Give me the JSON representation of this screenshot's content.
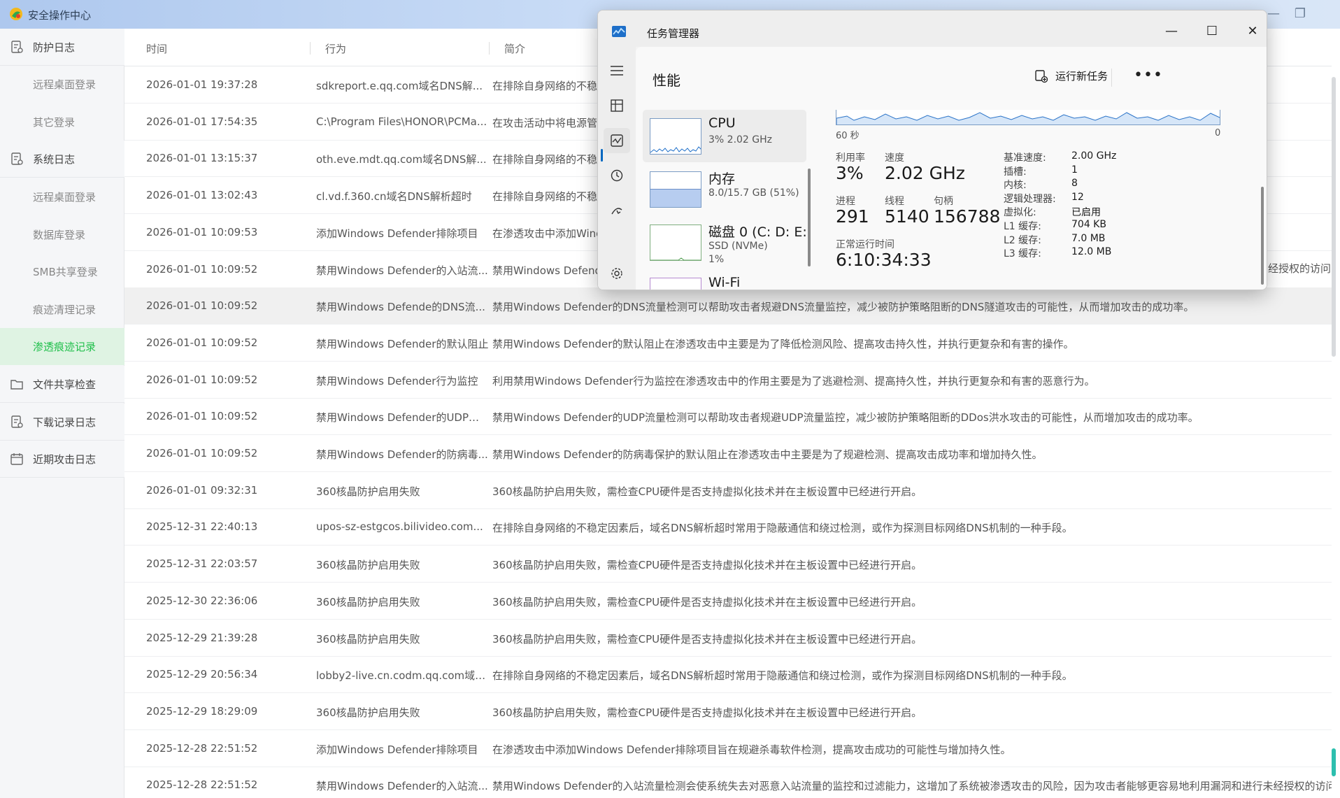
{
  "app": {
    "title": "安全操作中心",
    "sidebar": [
      {
        "label": "防护日志",
        "type": "group",
        "icon": "log-icon"
      },
      {
        "label": "远程桌面登录",
        "type": "sub"
      },
      {
        "label": "其它登录",
        "type": "sub"
      },
      {
        "label": "系统日志",
        "type": "group",
        "icon": "log-icon"
      },
      {
        "label": "远程桌面登录",
        "type": "sub"
      },
      {
        "label": "数据库登录",
        "type": "sub"
      },
      {
        "label": "SMB共享登录",
        "type": "sub"
      },
      {
        "label": "痕迹清理记录",
        "type": "sub"
      },
      {
        "label": "渗透痕迹记录",
        "type": "sub",
        "active": true
      },
      {
        "label": "文件共享检查",
        "type": "group",
        "icon": "folder-icon"
      },
      {
        "label": "下载记录日志",
        "type": "group",
        "icon": "log-icon"
      },
      {
        "label": "近期攻击日志",
        "type": "group",
        "icon": "calendar-icon"
      }
    ],
    "table": {
      "headers": {
        "time": "时间",
        "action": "行为",
        "desc": "简介"
      },
      "rows": [
        {
          "time": "2026-01-01 19:37:28",
          "action": "sdkreport.e.qq.com域名DNS解...",
          "desc": "在排除自身网络的不稳"
        },
        {
          "time": "2026-01-01 17:54:35",
          "action": "C:\\Program Files\\HONOR\\PCMa...",
          "desc": "在攻击活动中将电源管"
        },
        {
          "time": "2026-01-01 13:15:37",
          "action": "oth.eve.mdt.qq.com域名DNS解...",
          "desc": "在排除自身网络的不稳"
        },
        {
          "time": "2026-01-01 13:02:43",
          "action": "cl.vd.f.360.cn域名DNS解析超时",
          "desc": "在排除自身网络的不稳"
        },
        {
          "time": "2026-01-01 10:09:53",
          "action": "添加Windows Defender排除项目",
          "desc": "在渗透攻击中添加Wind"
        },
        {
          "time": "2026-01-01 10:09:52",
          "action": "禁用Windows Defender的入站流...",
          "desc": "禁用Windows Defend"
        },
        {
          "time": "2026-01-01 10:09:52",
          "action": "禁用Windows Defende的DNS流...",
          "desc": "禁用Windows Defender的DNS流量检测可以帮助攻击者规避DNS流量监控，减少被防护策略阻断的DNS隧道攻击的可能性，从而增加攻击的成功率。",
          "highlight": true
        },
        {
          "time": "2026-01-01 10:09:52",
          "action": "禁用Windows Defender的默认阻止",
          "desc": "禁用Windows Defender的默认阻止在渗透攻击中主要是为了降低检测风险、提高攻击持久性，并执行更复杂和有害的操作。"
        },
        {
          "time": "2026-01-01 10:09:52",
          "action": "禁用Windows Defender行为监控",
          "desc": "利用禁用Windows Defender行为监控在渗透攻击中的作用主要是为了逃避检测、提高持久性，并执行更复杂和有害的恶意行为。"
        },
        {
          "time": "2026-01-01 10:09:52",
          "action": "禁用Windows Defender的UDP流...",
          "desc": "禁用Windows Defender的UDP流量检测可以帮助攻击者规避UDP流量监控，减少被防护策略阻断的DDos洪水攻击的可能性，从而增加攻击的成功率。"
        },
        {
          "time": "2026-01-01 10:09:52",
          "action": "禁用Windows Defender的防病毒...",
          "desc": "禁用Windows Defender的防病毒保护的默认阻止在渗透攻击中主要是为了规避检测、提高攻击成功率和增加持久性。"
        },
        {
          "time": "2026-01-01 09:32:31",
          "action": "360核晶防护启用失败",
          "desc": "360核晶防护启用失败，需检查CPU硬件是否支持虚拟化技术并在主板设置中已经进行开启。"
        },
        {
          "time": "2025-12-31 22:40:13",
          "action": "upos-sz-estgcos.bilivideo.com...",
          "desc": "在排除自身网络的不稳定因素后，域名DNS解析超时常用于隐蔽通信和绕过检测，或作为探测目标网络DNS机制的一种手段。"
        },
        {
          "time": "2025-12-31 22:03:57",
          "action": "360核晶防护启用失败",
          "desc": "360核晶防护启用失败，需检查CPU硬件是否支持虚拟化技术并在主板设置中已经进行开启。"
        },
        {
          "time": "2025-12-30 22:36:06",
          "action": "360核晶防护启用失败",
          "desc": "360核晶防护启用失败，需检查CPU硬件是否支持虚拟化技术并在主板设置中已经进行开启。"
        },
        {
          "time": "2025-12-29 21:39:28",
          "action": "360核晶防护启用失败",
          "desc": "360核晶防护启用失败，需检查CPU硬件是否支持虚拟化技术并在主板设置中已经进行开启。"
        },
        {
          "time": "2025-12-29 20:56:34",
          "action": "lobby2-live.cn.codm.qq.com域名...",
          "desc": "在排除自身网络的不稳定因素后，域名DNS解析超时常用于隐蔽通信和绕过检测，或作为探测目标网络DNS机制的一种手段。"
        },
        {
          "time": "2025-12-29 18:29:09",
          "action": "360核晶防护启用失败",
          "desc": "360核晶防护启用失败，需检查CPU硬件是否支持虚拟化技术并在主板设置中已经进行开启。"
        },
        {
          "time": "2025-12-28 22:51:52",
          "action": "添加Windows Defender排除项目",
          "desc": "在渗透攻击中添加Windows Defender排除项目旨在规避杀毒软件检测，提高攻击成功的可能性与增加持久性。"
        },
        {
          "time": "2025-12-28 22:51:52",
          "action": "禁用Windows Defender的入站流...",
          "desc": "禁用Windows Defender的入站流量检测会使系统失去对恶意入站流量的监控和过滤能力，这增加了系统被渗透攻击的风险，因为攻击者能够更容易地利用漏洞和进行未经授权的访问"
        }
      ],
      "overflow_text_row6": "经授权的访问"
    }
  },
  "taskmgr": {
    "title": "任务管理器",
    "page_title": "性能",
    "run_task_label": "运行新任务",
    "more_label": "•••",
    "nav_icons": [
      "menu-icon",
      "processes-icon",
      "performance-icon",
      "history-icon",
      "startup-icon",
      "settings-icon"
    ],
    "resources": [
      {
        "name": "CPU",
        "line1": "3% 2.02 GHz",
        "line2": ""
      },
      {
        "name": "内存",
        "line1": "8.0/15.7 GB (51%)",
        "line2": ""
      },
      {
        "name": "磁盘 0 (C: D: E:",
        "line1": "SSD (NVMe)",
        "line2": "1%"
      },
      {
        "name": "Wi-Fi",
        "line1": "",
        "line2": ""
      }
    ],
    "graph": {
      "left_label": "60 秒",
      "right_label": "0"
    },
    "stats": {
      "util_label": "利用率",
      "util_value": "3%",
      "speed_label": "速度",
      "speed_value": "2.02 GHz",
      "proc_label": "进程",
      "proc_value": "291",
      "thread_label": "线程",
      "thread_value": "5140",
      "handle_label": "句柄",
      "handle_value": "156788",
      "uptime_label": "正常运行时间",
      "uptime_value": "6:10:34:33"
    },
    "details": [
      {
        "k": "基准速度:",
        "v": "2.00 GHz"
      },
      {
        "k": "插槽:",
        "v": "1"
      },
      {
        "k": "内核:",
        "v": "8"
      },
      {
        "k": "逻辑处理器:",
        "v": "12"
      },
      {
        "k": "虚拟化:",
        "v": "已启用"
      },
      {
        "k": "L1 缓存:",
        "v": "704 KB"
      },
      {
        "k": "L2 缓存:",
        "v": "7.0 MB"
      },
      {
        "k": "L3 缓存:",
        "v": "12.0 MB"
      }
    ]
  }
}
